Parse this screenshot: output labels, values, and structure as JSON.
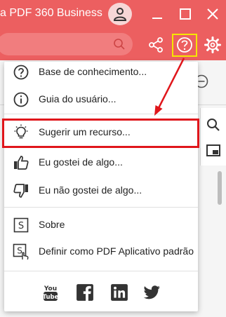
{
  "window": {
    "title": "a PDF 360 Business"
  },
  "menu": {
    "items": [
      {
        "label": "Base de conhecimento...",
        "icon": "help-circle-icon"
      },
      {
        "label": "Guia do usuário...",
        "icon": "info-icon"
      },
      {
        "label": "Sugerir um recurso...",
        "icon": "lightbulb-icon"
      },
      {
        "label": "Eu gostei de algo...",
        "icon": "thumbs-up-icon"
      },
      {
        "label": "Eu não gostei de algo...",
        "icon": "thumbs-down-icon"
      },
      {
        "label": "Sobre",
        "icon": "app-logo-icon"
      },
      {
        "label": "Definir como PDF Aplicativo padrão",
        "icon": "set-default-app-icon"
      }
    ],
    "social": [
      "youtube-icon",
      "facebook-icon",
      "linkedin-icon",
      "twitter-icon"
    ]
  },
  "colors": {
    "titlebar": "#ec5f60",
    "annotation_red": "#e0161b",
    "annotation_yellow": "#f5e600"
  }
}
